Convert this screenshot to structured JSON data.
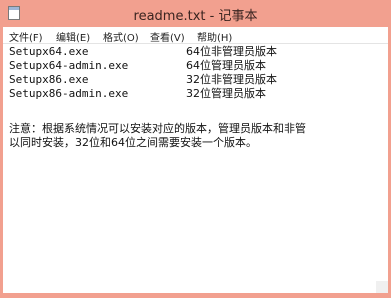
{
  "window": {
    "title": "readme.txt - 记事本"
  },
  "menu": [
    {
      "label": "文件(F)"
    },
    {
      "label": "编辑(E)"
    },
    {
      "label": "格式(O)"
    },
    {
      "label": "查看(V)"
    },
    {
      "label": "帮助(H)"
    }
  ],
  "content": {
    "rows": [
      {
        "file": "Setupx64.exe",
        "desc": "64位非管理员版本"
      },
      {
        "file": "Setupx64-admin.exe",
        "desc": "64位管理员版本"
      },
      {
        "file": "Setupx86.exe",
        "desc": "32位非管理员版本"
      },
      {
        "file": "Setupx86-admin.exe",
        "desc": "32位管理员版本"
      }
    ],
    "note_line1": "注意：根据系统情况可以安装对应的版本，管理员版本和非管",
    "note_line2": "以同时安装，32位和64位之间需要安装一个版本。"
  },
  "colors": {
    "titlebar": "#f2a08f",
    "editor_bg": "#ffffff"
  }
}
